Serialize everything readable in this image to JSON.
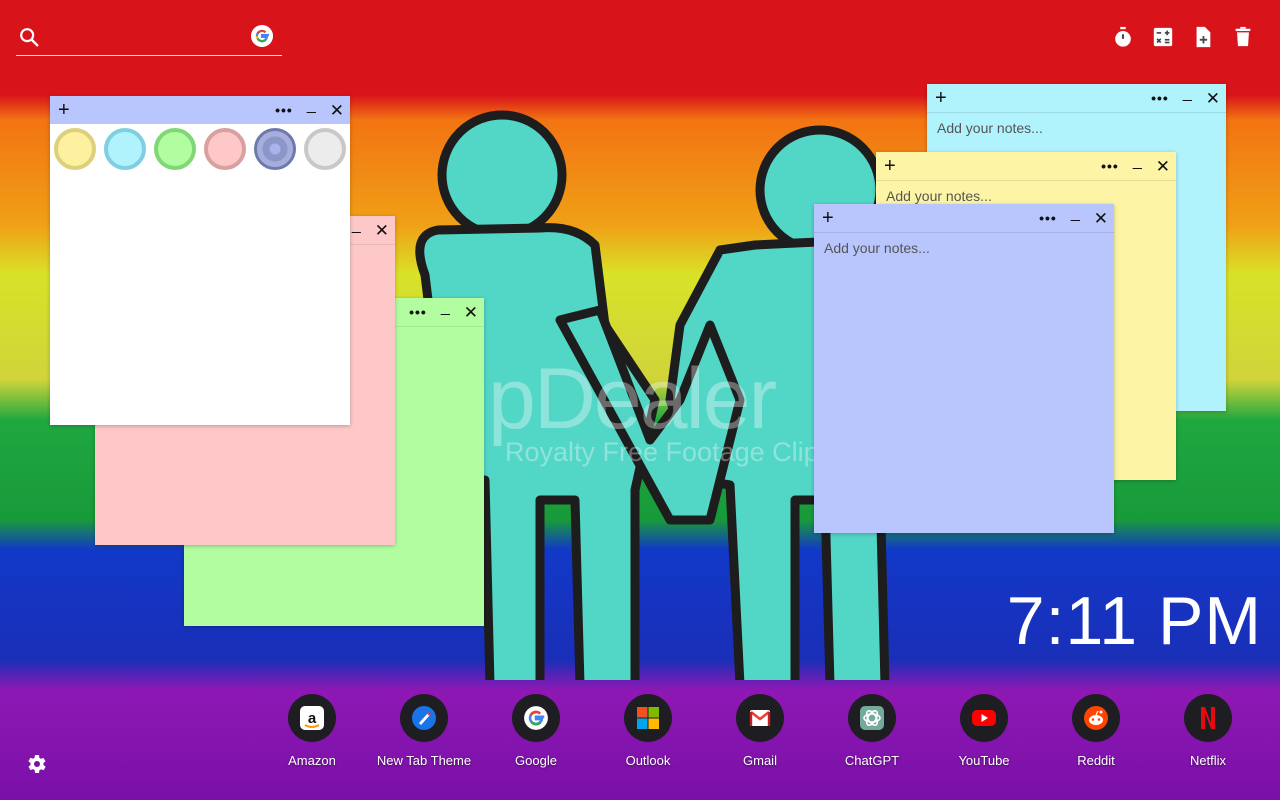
{
  "search": {
    "placeholder": ""
  },
  "top_icons": [
    "timer-icon",
    "calculator-icon",
    "new-note-icon",
    "trash-icon"
  ],
  "watermark": {
    "line1": "pDealer",
    "line2": "Royalty Free Footage Clips"
  },
  "notes": {
    "placeholder": "Add your notes...",
    "colors": {
      "white": "#ffffff",
      "pink": "#fec8c8",
      "green": "#b2fda0",
      "blue": "#b0f3fd",
      "yellow": "#fdf5a5",
      "periwinkle": "#b8c6fd"
    },
    "swatches": [
      {
        "name": "yellow",
        "fill": "#fdf1a0",
        "ring": "#dcd07a"
      },
      {
        "name": "blue",
        "fill": "#b0f3fd",
        "ring": "#7fcfe0"
      },
      {
        "name": "green",
        "fill": "#b2fda0",
        "ring": "#80d874"
      },
      {
        "name": "pink",
        "fill": "#fec8c8",
        "ring": "#d9a0a0"
      },
      {
        "name": "periwinkle",
        "fill": "#8c96c8",
        "ring": "#6f79ad"
      },
      {
        "name": "white",
        "fill": "#ececec",
        "ring": "#c8c8c8"
      }
    ]
  },
  "clock": {
    "time": "7:11 PM"
  },
  "shortcuts": [
    {
      "label": "Amazon",
      "icon": "amazon-icon"
    },
    {
      "label": "New Tab Theme",
      "icon": "new-tab-theme-icon"
    },
    {
      "label": "Google",
      "icon": "google-icon"
    },
    {
      "label": "Outlook",
      "icon": "outlook-icon"
    },
    {
      "label": "Gmail",
      "icon": "gmail-icon"
    },
    {
      "label": "ChatGPT",
      "icon": "chatgpt-icon"
    },
    {
      "label": "YouTube",
      "icon": "youtube-icon"
    },
    {
      "label": "Reddit",
      "icon": "reddit-icon"
    },
    {
      "label": "Netflix",
      "icon": "netflix-icon"
    }
  ]
}
